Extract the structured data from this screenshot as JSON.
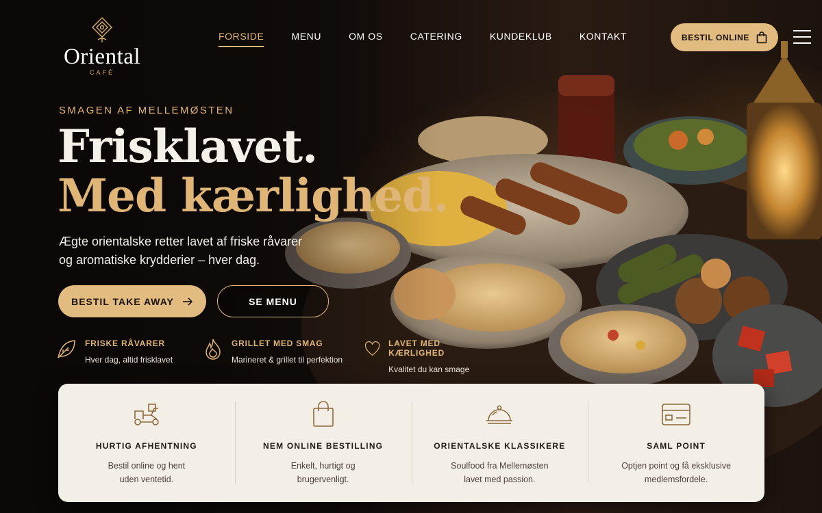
{
  "brand": {
    "name": "Oriental",
    "sub": "CAFÉ"
  },
  "nav": {
    "items": [
      {
        "label": "FORSIDE",
        "active": true
      },
      {
        "label": "MENU"
      },
      {
        "label": "OM OS"
      },
      {
        "label": "CATERING"
      },
      {
        "label": "KUNDEKLUB"
      },
      {
        "label": "KONTAKT"
      }
    ],
    "order_label": "BESTIL ONLINE"
  },
  "hero": {
    "eyebrow": "SMAGEN AF MELLEMØSTEN",
    "headline_1": "Frisklavet.",
    "headline_2": "Med kærlighed.",
    "lead": "Ægte orientalske retter lavet af friske råvarer og aromatiske krydderier – hver dag.",
    "cta_primary": "BESTIL TAKE AWAY",
    "cta_secondary": "SE MENU"
  },
  "features": [
    {
      "icon": "leaf-icon",
      "title": "FRISKE RÅVARER",
      "desc": "Hver dag, altid frisklavet"
    },
    {
      "icon": "flame-icon",
      "title": "GRILLET MED SMAG",
      "desc": "Marineret & grillet til perfektion"
    },
    {
      "icon": "heart-icon",
      "title": "LAVET MED KÆRLIGHED",
      "desc": "Kvalitet du kan smage"
    }
  ],
  "highlights": [
    {
      "icon": "delivery-scooter-icon",
      "title": "HURTIG AFHENTNING",
      "desc_1": "Bestil online og hent",
      "desc_2": "uden ventetid."
    },
    {
      "icon": "shopping-bag-icon",
      "title": "NEM ONLINE BESTILLING",
      "desc_1": "Enkelt, hurtigt og",
      "desc_2": "brugervenligt."
    },
    {
      "icon": "cloche-icon",
      "title": "ORIENTALSKE KLASSIKERE",
      "desc_1": "Soulfood fra Mellemøsten",
      "desc_2": "lavet med passion."
    },
    {
      "icon": "loyalty-card-icon",
      "title": "SAML POINT",
      "desc_1": "Optjen point og få eksklusive",
      "desc_2": "medlemsfordele."
    }
  ],
  "colors": {
    "accent": "#e1bb7f",
    "background": "#0d0a08",
    "card": "#f4efe6"
  }
}
